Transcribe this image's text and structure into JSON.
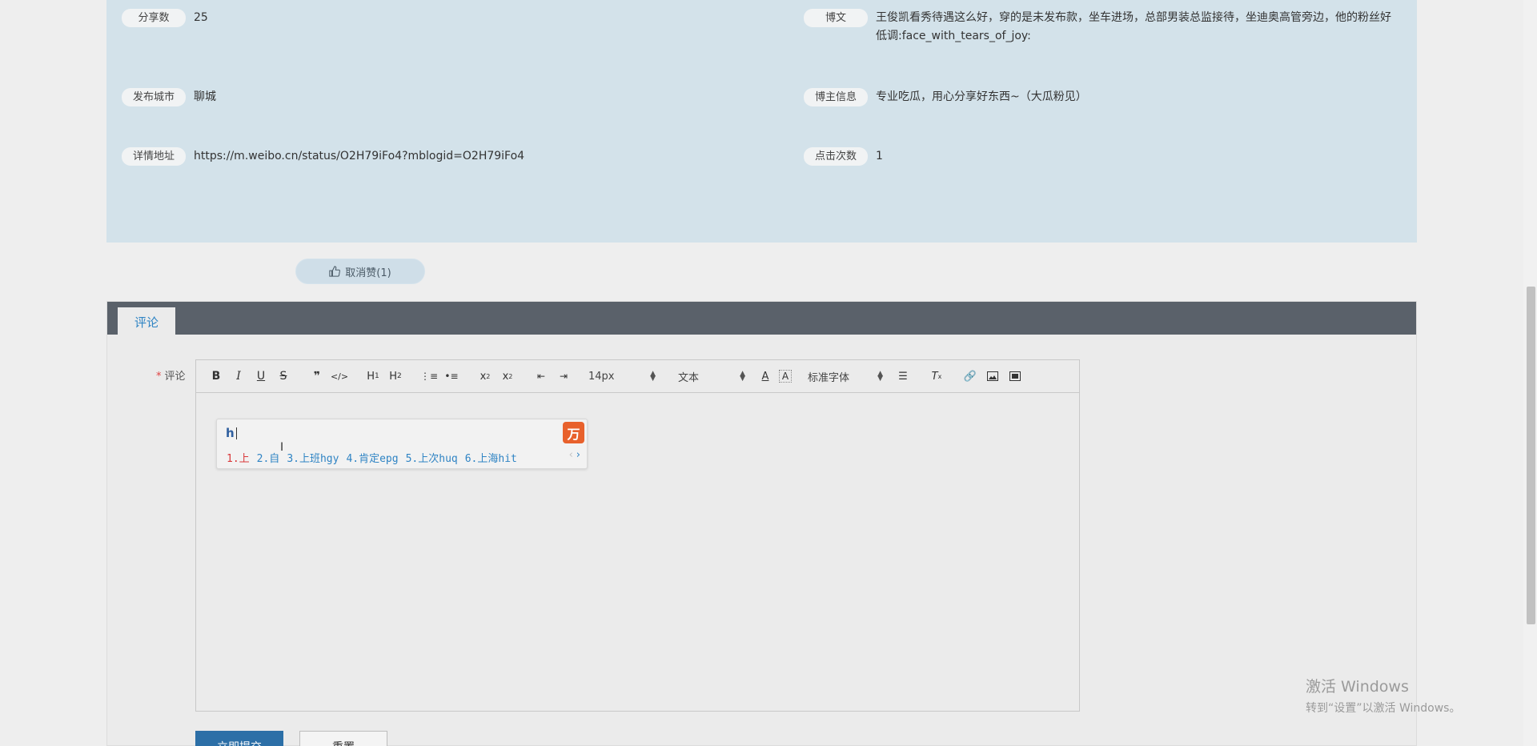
{
  "info": {
    "share_label": "分享数",
    "share_value": "25",
    "city_label": "发布城市",
    "city_value": "聊城",
    "url_label": "详情地址",
    "url_value": "https://m.weibo.cn/status/O2H79iFo4?mblogid=O2H79iFo4",
    "post_label": "博文",
    "post_value": "王俊凯看秀待遇这么好，穿的是未发布款，坐车进场，总部男装总监接待，坐迪奥高管旁边，他的粉丝好低调:face_with_tears_of_joy:",
    "blogger_label": "博主信息",
    "blogger_value": "专业吃瓜，用心分享好东西~（大瓜粉见）",
    "clicks_label": "点击次数",
    "clicks_value": "1"
  },
  "like_button": {
    "label": "取消赞(1)",
    "icon": "thumbs-up-icon"
  },
  "comment": {
    "tab_label": "评论",
    "required_mark": "*",
    "field_label": "评论",
    "font_size": "14px",
    "block_type": "文本",
    "font_family": "标准字体"
  },
  "ime": {
    "input": "h",
    "candidates": [
      "1.上",
      "2.自",
      "3.上班hgy",
      "4.肯定epg",
      "5.上次huq",
      "6.上海hit"
    ],
    "prev": "‹",
    "next": "›",
    "logo": "万"
  },
  "buttons": {
    "submit": "立即提交",
    "reset": "重置"
  },
  "watermark": {
    "line1": "激活 Windows",
    "line2": "转到“设置”以激活 Windows。"
  }
}
